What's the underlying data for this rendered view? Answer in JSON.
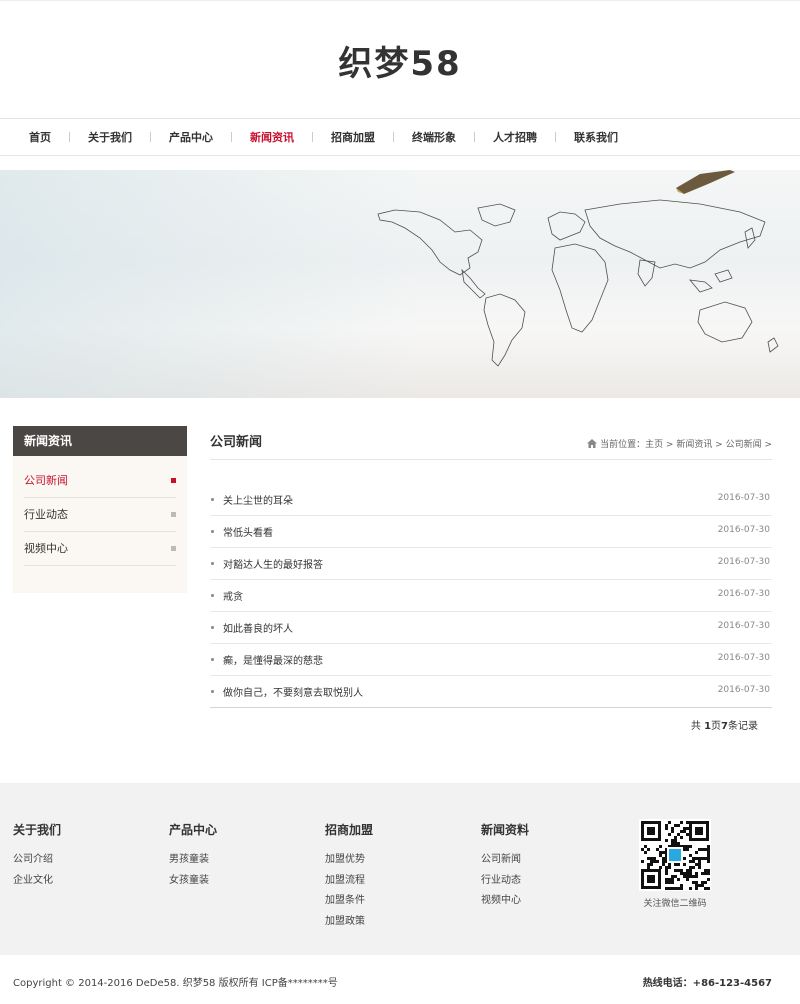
{
  "site": {
    "logo": "织梦58"
  },
  "nav": {
    "items": [
      {
        "label": "首页"
      },
      {
        "label": "关于我们"
      },
      {
        "label": "产品中心"
      },
      {
        "label": "新闻资讯"
      },
      {
        "label": "招商加盟"
      },
      {
        "label": "终端形象"
      },
      {
        "label": "人才招聘"
      },
      {
        "label": "联系我们"
      }
    ],
    "active": "新闻资讯"
  },
  "sidebar": {
    "title": "新闻资讯",
    "items": [
      {
        "label": "公司新闻"
      },
      {
        "label": "行业动态"
      },
      {
        "label": "视频中心"
      }
    ],
    "active": "公司新闻"
  },
  "main": {
    "title": "公司新闻",
    "breadcrumb": "当前位置：主页 > 新闻资讯 > 公司新闻 >",
    "news": [
      {
        "title": "关上尘世的耳朵",
        "date": "2016-07-30"
      },
      {
        "title": "常低头看看",
        "date": "2016-07-30"
      },
      {
        "title": "对豁达人生的最好报答",
        "date": "2016-07-30"
      },
      {
        "title": "戒贪",
        "date": "2016-07-30"
      },
      {
        "title": "如此善良的坏人",
        "date": "2016-07-30"
      },
      {
        "title": "癫，是懂得最深的慈悲",
        "date": "2016-07-30"
      },
      {
        "title": "做你自己，不要刻意去取悦别人",
        "date": "2016-07-30"
      }
    ],
    "pager": {
      "prefix": "共 ",
      "pages": "1",
      "mid": "页",
      "count": "7",
      "suffix": "条记录"
    }
  },
  "footer": {
    "columns": [
      {
        "title": "关于我们",
        "links": [
          "公司介绍",
          "企业文化"
        ]
      },
      {
        "title": "产品中心",
        "links": [
          "男孩童装",
          "女孩童装"
        ]
      },
      {
        "title": "招商加盟",
        "links": [
          "加盟优势",
          "加盟流程",
          "加盟条件",
          "加盟政策"
        ]
      },
      {
        "title": "新闻资料",
        "links": [
          "公司新闻",
          "行业动态",
          "视频中心"
        ]
      }
    ],
    "qr_caption": "关注微信二维码",
    "copyright": "Copyright © 2014-2016 DeDe58. 织梦58 版权所有  ICP备********号",
    "hotline": "热线电话：+86-123-4567"
  },
  "colors": {
    "accent": "#c8102e",
    "sidebar_header": "#4b4744",
    "footer_bg": "#f2f2f2"
  },
  "icons": {
    "home": "home-icon",
    "qr": "qr-code-icon"
  }
}
